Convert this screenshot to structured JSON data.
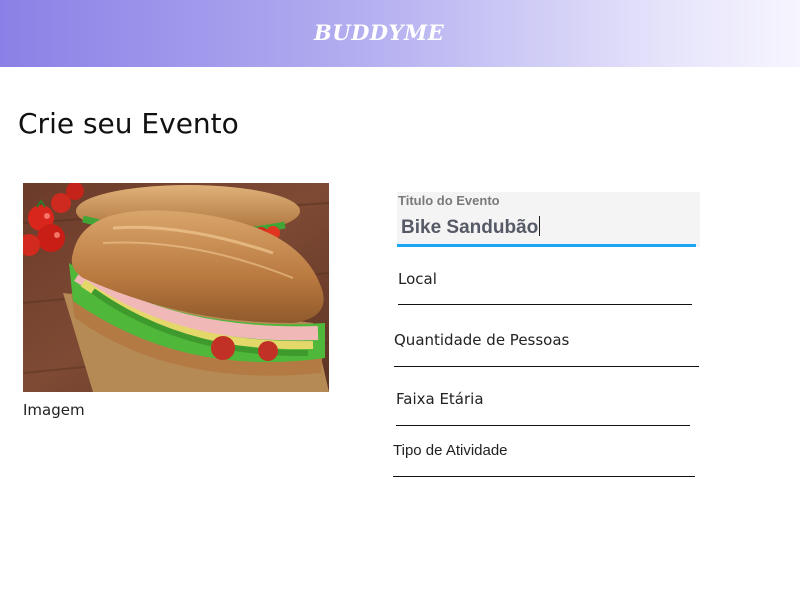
{
  "header": {
    "brand": "BUDDYME",
    "gradient_start": "#8a80e6",
    "gradient_end": "#f6f5fe"
  },
  "main": {
    "title": "Crie seu Evento",
    "image_caption": "Imagem",
    "form": {
      "title_field": {
        "label": "Titulo do Evento",
        "value": "Bike Sandubão",
        "accent": "#1aa6f2"
      },
      "local_label": "Local",
      "people_label": "Quantidade de Pessoas",
      "age_label": "Faixa Etária",
      "activity_label": "Tipo de Atividade"
    }
  }
}
